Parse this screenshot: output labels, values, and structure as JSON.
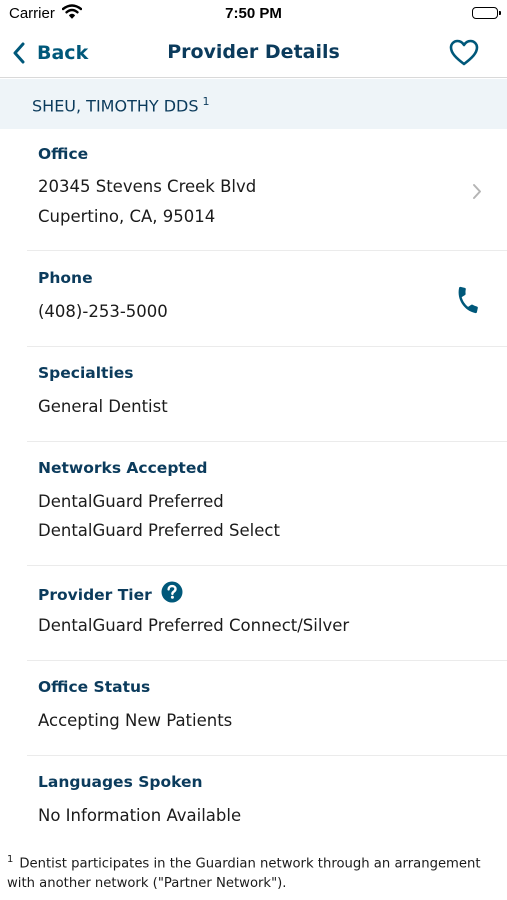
{
  "status_bar": {
    "carrier": "Carrier",
    "time": "7:50 PM"
  },
  "nav": {
    "back_label": "Back",
    "title": "Provider Details"
  },
  "provider": {
    "name": "SHEU, TIMOTHY DDS",
    "footnote_ref": "1"
  },
  "office": {
    "label": "Office",
    "line1": "20345 Stevens Creek Blvd",
    "line2": "Cupertino, CA, 95014"
  },
  "phone": {
    "label": "Phone",
    "value": "(408)-253-5000"
  },
  "specialties": {
    "label": "Specialties",
    "value": "General Dentist"
  },
  "networks": {
    "label": "Networks Accepted",
    "line1": "DentalGuard Preferred",
    "line2": "DentalGuard Preferred Select"
  },
  "tier": {
    "label": "Provider Tier",
    "value": "DentalGuard Preferred Connect/Silver"
  },
  "office_status": {
    "label": "Office Status",
    "value": "Accepting New Patients"
  },
  "languages": {
    "label": "Languages Spoken",
    "value": "No Information Available"
  },
  "footnote": {
    "marker": "1",
    "line1": "Dentist participates in the Guardian network through an arrangement",
    "line2": "with another network (\"Partner Network\")."
  },
  "colors": {
    "accent": "#00587a",
    "navy": "#0b3b5c",
    "header_bg": "#eef4f8"
  }
}
